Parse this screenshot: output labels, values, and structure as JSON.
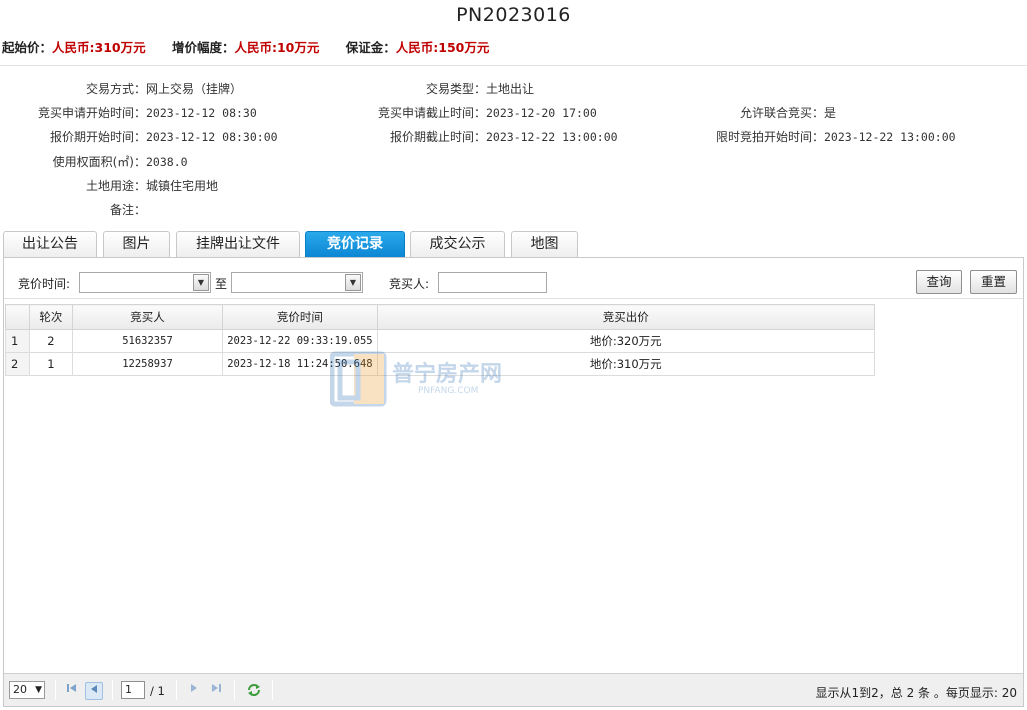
{
  "title": "PN2023016",
  "price_bar": {
    "start_label": "起始价：",
    "start_value": "人民币:310万元",
    "step_label": "增价幅度：",
    "step_value": "人民币:10万元",
    "deposit_label": "保证金：",
    "deposit_value": "人民币:150万元"
  },
  "info": {
    "trade_mode_label": "交易方式：",
    "trade_mode": "网上交易（挂牌）",
    "trade_type_label": "交易类型：",
    "trade_type": "土地出让",
    "apply_start_label": "竞买申请开始时间：",
    "apply_start": "2023-12-12 08:30",
    "apply_end_label": "竞买申请截止时间：",
    "apply_end": "2023-12-20 17:00",
    "joint_label": "允许联合竞买：",
    "joint": "是",
    "quote_start_label": "报价期开始时间：",
    "quote_start": "2023-12-12 08:30:00",
    "quote_end_label": "报价期截止时间：",
    "quote_end": "2023-12-22 13:00:00",
    "auction_start_label": "限时竞拍开始时间：",
    "auction_start": "2023-12-22 13:00:00",
    "area_label": "使用权面积(㎡)：",
    "area": "2038.0",
    "usage_label": "土地用途：",
    "usage": "城镇住宅用地",
    "remark_label": "备注：",
    "remark": ""
  },
  "tabs": [
    "出让公告",
    "图片",
    "挂牌出让文件",
    "竞价记录",
    "成交公示",
    "地图"
  ],
  "active_tab": "竞价记录",
  "search": {
    "time_label": "竞价时间:",
    "to_label": "至",
    "bidder_label": "竞买人:",
    "query_label": "查询",
    "reset_label": "重置"
  },
  "grid": {
    "columns": [
      "轮次",
      "竞买人",
      "竞价时间",
      "竞买出价"
    ],
    "rows": [
      {
        "no": "1",
        "round": "2",
        "bidder": "51632357",
        "time": "2023-12-22 09:33:19.055",
        "price": "地价:320万元"
      },
      {
        "no": "2",
        "round": "1",
        "bidder": "12258937",
        "time": "2023-12-18 11:24:50.648",
        "price": "地价:310万元"
      }
    ]
  },
  "watermark": {
    "name": "普宁房产网",
    "domain": "PNFANG.COM"
  },
  "pager": {
    "page_size": "20",
    "current_page": "1",
    "total_pages": "/ 1",
    "info": "显示从1到2，总 2 条 。每页显示: 20"
  },
  "colors": {
    "accent_red": "#c00000",
    "tab_active": "#0b86d4"
  }
}
